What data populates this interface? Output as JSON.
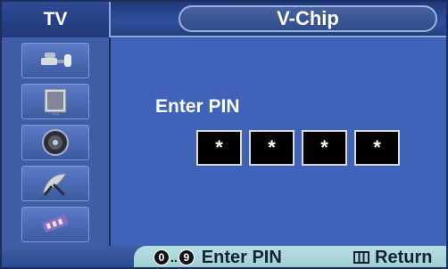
{
  "header": {
    "tab_label": "TV",
    "title": "V-Chip"
  },
  "sidebar": {
    "items": [
      {
        "icon": "input-plug-icon"
      },
      {
        "icon": "picture-icon"
      },
      {
        "icon": "sound-speaker-icon"
      },
      {
        "icon": "channel-antenna-icon"
      },
      {
        "icon": "setup-icon"
      }
    ]
  },
  "content": {
    "prompt": "Enter PIN",
    "pin_boxes": [
      "*",
      "*",
      "*",
      "*"
    ]
  },
  "footer": {
    "num_start": "0",
    "num_sep": "..",
    "num_end": "9",
    "enter_label": "Enter PIN",
    "return_label": "Return"
  },
  "colors": {
    "background": "#3f63b6",
    "footer": "#b5dfe1",
    "pin_box": "#000000"
  }
}
